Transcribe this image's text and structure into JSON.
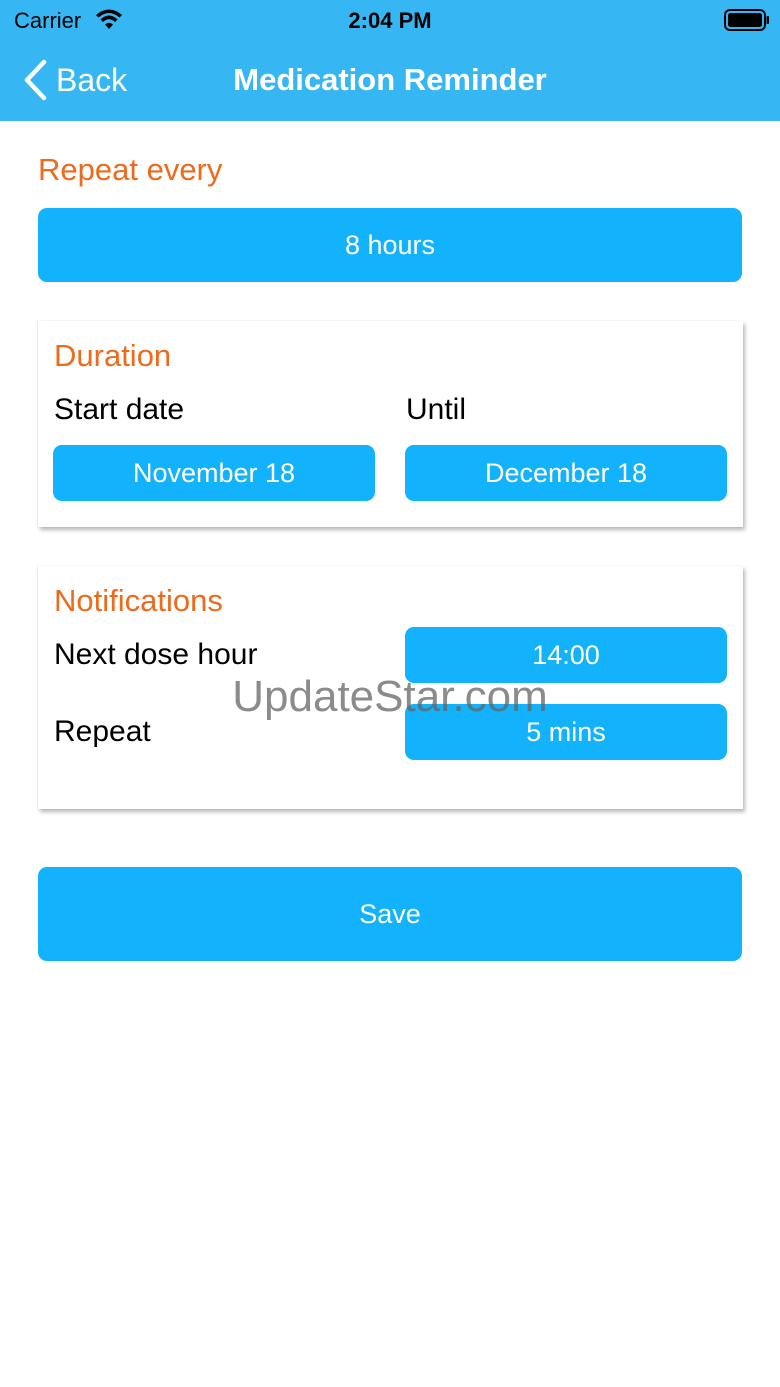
{
  "status_bar": {
    "carrier": "Carrier",
    "time": "2:04 PM",
    "icons": [
      "wifi-icon",
      "battery-icon"
    ]
  },
  "nav": {
    "back_label": "Back",
    "title": "Medication Reminder",
    "back_icon": "chevron-left-icon"
  },
  "repeat_every": {
    "label": "Repeat every",
    "value": "8 hours"
  },
  "duration": {
    "label": "Duration",
    "start_label": "Start date",
    "start_value": "November 18",
    "until_label": "Until",
    "until_value": "December 18"
  },
  "notifications": {
    "label": "Notifications",
    "next_dose_label": "Next dose hour",
    "next_dose_value": "14:00",
    "repeat_label": "Repeat",
    "repeat_value": "5 mins"
  },
  "save_label": "Save",
  "watermark": "UpdateStar.com",
  "colors": {
    "header": "#36b7f3",
    "button": "#12b2fc",
    "section_label": "#ee6a1c"
  }
}
